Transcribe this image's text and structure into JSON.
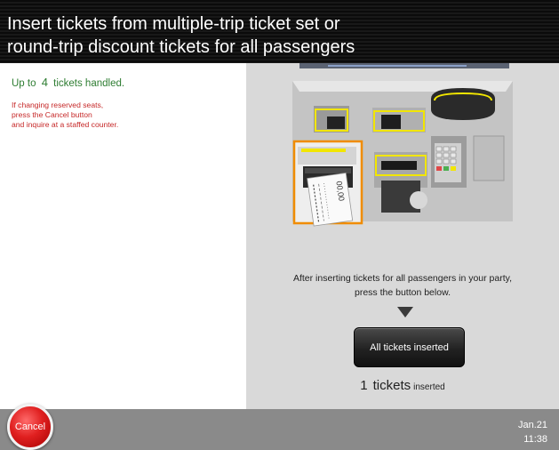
{
  "header": {
    "title_line1": "Insert tickets from multiple-trip ticket set or",
    "title_line2": "round-trip discount tickets for all passengers"
  },
  "left_panel": {
    "count_prefix": "Up to",
    "count_value": "4",
    "count_suffix": "tickets handled.",
    "warning_lines": [
      "If changing reserved seats,",
      "press the Cancel button",
      "and inquire at a staffed counter."
    ]
  },
  "right_panel": {
    "instruction_line1": "After inserting tickets for all passengers in your party,",
    "instruction_line2": "press the button below.",
    "all_inserted_button": "All tickets inserted",
    "inserted_count": "1",
    "inserted_word": "tickets",
    "inserted_suffix": "inserted",
    "ticket_print": "00,00"
  },
  "footer": {
    "cancel_label": "Cancel",
    "date": "Jan.21",
    "time": "11:38"
  },
  "colors": {
    "count_text": "#2e7d32",
    "warning_text": "#c62828",
    "highlight": "#f08c00",
    "slot_outline": "#f2e600",
    "cancel_button": "#e02020"
  }
}
